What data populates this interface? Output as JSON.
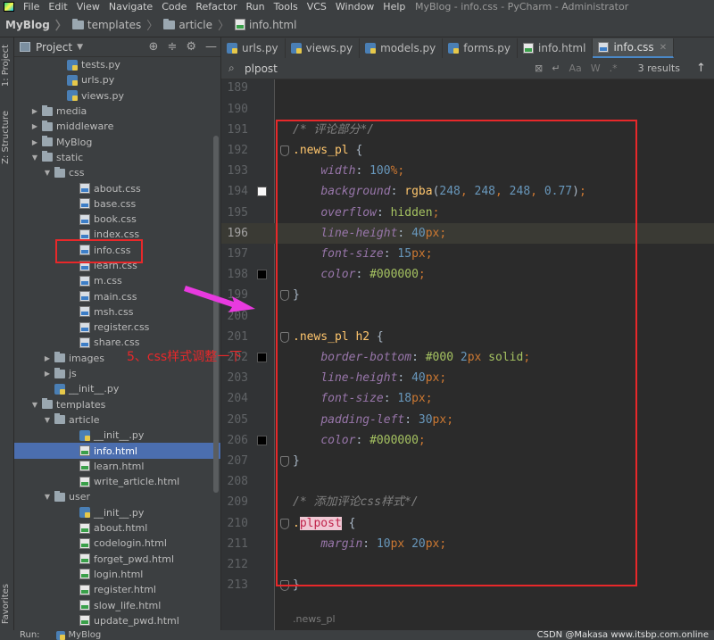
{
  "menubar": {
    "items": [
      "File",
      "Edit",
      "View",
      "Navigate",
      "Code",
      "Refactor",
      "Run",
      "Tools",
      "VCS",
      "Window",
      "Help"
    ],
    "window_title": "MyBlog - info.css - PyCharm - Administrator"
  },
  "breadcrumb": [
    "MyBlog",
    "templates",
    "article",
    "info.html"
  ],
  "left_strip": {
    "project_tab": "1: Project",
    "structure_tab": "Z: Structure",
    "favorites_tab": "Favorites"
  },
  "project_panel": {
    "title": "Project",
    "tree": [
      {
        "label": "tests.py",
        "type": "py",
        "depth": 4,
        "arrow": ""
      },
      {
        "label": "urls.py",
        "type": "py",
        "depth": 4,
        "arrow": ""
      },
      {
        "label": "views.py",
        "type": "py",
        "depth": 4,
        "arrow": ""
      },
      {
        "label": "media",
        "type": "folder",
        "depth": 2,
        "arrow": "▶"
      },
      {
        "label": "middleware",
        "type": "folder",
        "depth": 2,
        "arrow": "▶"
      },
      {
        "label": "MyBlog",
        "type": "folder",
        "depth": 2,
        "arrow": "▶"
      },
      {
        "label": "static",
        "type": "folder",
        "depth": 2,
        "arrow": "▼"
      },
      {
        "label": "css",
        "type": "folder",
        "depth": 3,
        "arrow": "▼"
      },
      {
        "label": "about.css",
        "type": "css",
        "depth": 5,
        "arrow": ""
      },
      {
        "label": "base.css",
        "type": "css",
        "depth": 5,
        "arrow": ""
      },
      {
        "label": "book.css",
        "type": "css",
        "depth": 5,
        "arrow": ""
      },
      {
        "label": "index.css",
        "type": "css",
        "depth": 5,
        "arrow": ""
      },
      {
        "label": "info.css",
        "type": "css",
        "depth": 5,
        "arrow": ""
      },
      {
        "label": "learn.css",
        "type": "css",
        "depth": 5,
        "arrow": ""
      },
      {
        "label": "m.css",
        "type": "css",
        "depth": 5,
        "arrow": ""
      },
      {
        "label": "main.css",
        "type": "css",
        "depth": 5,
        "arrow": ""
      },
      {
        "label": "msh.css",
        "type": "css",
        "depth": 5,
        "arrow": ""
      },
      {
        "label": "register.css",
        "type": "css",
        "depth": 5,
        "arrow": ""
      },
      {
        "label": "share.css",
        "type": "css",
        "depth": 5,
        "arrow": ""
      },
      {
        "label": "images",
        "type": "folder",
        "depth": 3,
        "arrow": "▶"
      },
      {
        "label": "js",
        "type": "folder",
        "depth": 3,
        "arrow": "▶"
      },
      {
        "label": "__init__.py",
        "type": "py",
        "depth": 3,
        "arrow": ""
      },
      {
        "label": "templates",
        "type": "folder",
        "depth": 2,
        "arrow": "▼"
      },
      {
        "label": "article",
        "type": "folder",
        "depth": 3,
        "arrow": "▼"
      },
      {
        "label": "__init__.py",
        "type": "py",
        "depth": 5,
        "arrow": ""
      },
      {
        "label": "info.html",
        "type": "html",
        "depth": 5,
        "arrow": "",
        "selected": true
      },
      {
        "label": "learn.html",
        "type": "html",
        "depth": 5,
        "arrow": ""
      },
      {
        "label": "write_article.html",
        "type": "html",
        "depth": 5,
        "arrow": ""
      },
      {
        "label": "user",
        "type": "folder",
        "depth": 3,
        "arrow": "▼"
      },
      {
        "label": "__init__.py",
        "type": "py",
        "depth": 5,
        "arrow": ""
      },
      {
        "label": "about.html",
        "type": "html",
        "depth": 5,
        "arrow": ""
      },
      {
        "label": "codelogin.html",
        "type": "html",
        "depth": 5,
        "arrow": ""
      },
      {
        "label": "forget_pwd.html",
        "type": "html",
        "depth": 5,
        "arrow": ""
      },
      {
        "label": "login.html",
        "type": "html",
        "depth": 5,
        "arrow": ""
      },
      {
        "label": "register.html",
        "type": "html",
        "depth": 5,
        "arrow": ""
      },
      {
        "label": "slow_life.html",
        "type": "html",
        "depth": 5,
        "arrow": ""
      },
      {
        "label": "update_pwd.html",
        "type": "html",
        "depth": 5,
        "arrow": ""
      }
    ]
  },
  "editor_tabs": [
    {
      "label": "urls.py",
      "type": "py",
      "active": false
    },
    {
      "label": "views.py",
      "type": "py",
      "active": false
    },
    {
      "label": "models.py",
      "type": "py",
      "active": false
    },
    {
      "label": "forms.py",
      "type": "py",
      "active": false
    },
    {
      "label": "info.html",
      "type": "html",
      "active": false
    },
    {
      "label": "info.css",
      "type": "css",
      "active": true
    }
  ],
  "search": {
    "value": "plpost",
    "results": "3 results",
    "options": [
      "Aa",
      "W",
      ".*"
    ]
  },
  "code_lines": [
    {
      "ln": "189",
      "tokens": []
    },
    {
      "ln": "190",
      "tokens": []
    },
    {
      "ln": "191",
      "tokens": [
        [
          "c-comment",
          "/* 评论部分*/"
        ]
      ]
    },
    {
      "ln": "192",
      "fold": true,
      "tokens": [
        [
          "c-sel",
          ".news_pl"
        ],
        [
          "c-text",
          " {"
        ]
      ]
    },
    {
      "ln": "193",
      "tokens": [
        [
          "c-text",
          "    "
        ],
        [
          "c-prop b",
          "width"
        ],
        [
          "c-text",
          ": "
        ],
        [
          "c-num",
          "100"
        ],
        [
          "c-unit",
          "%;"
        ]
      ]
    },
    {
      "ln": "194",
      "swatch": "#f8f8f8",
      "tokens": [
        [
          "c-text",
          "    "
        ],
        [
          "c-prop b",
          "background"
        ],
        [
          "c-text",
          ": "
        ],
        [
          "c-fn",
          "rgba"
        ],
        [
          "c-text",
          "("
        ],
        [
          "c-num",
          "248"
        ],
        [
          "c-kw",
          ", "
        ],
        [
          "c-num",
          "248"
        ],
        [
          "c-kw",
          ", "
        ],
        [
          "c-num",
          "248"
        ],
        [
          "c-kw",
          ", "
        ],
        [
          "c-num",
          "0.77"
        ],
        [
          "c-text",
          ")"
        ],
        [
          "c-kw",
          ";"
        ]
      ]
    },
    {
      "ln": "195",
      "tokens": [
        [
          "c-text",
          "    "
        ],
        [
          "c-prop b",
          "overflow"
        ],
        [
          "c-text",
          ": "
        ],
        [
          "c-color",
          "hidden"
        ],
        [
          "c-kw",
          ";"
        ]
      ]
    },
    {
      "ln": "196",
      "current": true,
      "tokens": [
        [
          "c-text",
          "    "
        ],
        [
          "c-prop b",
          "line-height"
        ],
        [
          "c-text",
          ": "
        ],
        [
          "c-num",
          "40"
        ],
        [
          "c-unit",
          "px"
        ],
        [
          "c-kw",
          ";"
        ]
      ]
    },
    {
      "ln": "197",
      "tokens": [
        [
          "c-text",
          "    "
        ],
        [
          "c-prop b",
          "font-size"
        ],
        [
          "c-text",
          ": "
        ],
        [
          "c-num",
          "15"
        ],
        [
          "c-unit",
          "px"
        ],
        [
          "c-kw",
          ";"
        ]
      ]
    },
    {
      "ln": "198",
      "swatch": "#000000",
      "tokens": [
        [
          "c-text",
          "    "
        ],
        [
          "c-prop b",
          "color"
        ],
        [
          "c-text",
          ": "
        ],
        [
          "c-color",
          "#000000"
        ],
        [
          "c-kw",
          ";"
        ]
      ]
    },
    {
      "ln": "199",
      "fold": true,
      "tokens": [
        [
          "c-text",
          "}"
        ]
      ]
    },
    {
      "ln": "200",
      "tokens": []
    },
    {
      "ln": "201",
      "fold": true,
      "tokens": [
        [
          "c-sel",
          ".news_pl h2"
        ],
        [
          "c-text",
          " {"
        ]
      ]
    },
    {
      "ln": "202",
      "swatch": "#000000",
      "tokens": [
        [
          "c-text",
          "    "
        ],
        [
          "c-prop b",
          "border-bottom"
        ],
        [
          "c-text",
          ": "
        ],
        [
          "c-color",
          "#000"
        ],
        [
          "c-text",
          " "
        ],
        [
          "c-num",
          "2"
        ],
        [
          "c-unit",
          "px"
        ],
        [
          "c-text",
          " "
        ],
        [
          "c-color",
          "solid"
        ],
        [
          "c-kw",
          ";"
        ]
      ]
    },
    {
      "ln": "203",
      "tokens": [
        [
          "c-text",
          "    "
        ],
        [
          "c-prop b",
          "line-height"
        ],
        [
          "c-text",
          ": "
        ],
        [
          "c-num",
          "40"
        ],
        [
          "c-unit",
          "px"
        ],
        [
          "c-kw",
          ";"
        ]
      ]
    },
    {
      "ln": "204",
      "tokens": [
        [
          "c-text",
          "    "
        ],
        [
          "c-prop b",
          "font-size"
        ],
        [
          "c-text",
          ": "
        ],
        [
          "c-num",
          "18"
        ],
        [
          "c-unit",
          "px"
        ],
        [
          "c-kw",
          ";"
        ]
      ]
    },
    {
      "ln": "205",
      "tokens": [
        [
          "c-text",
          "    "
        ],
        [
          "c-prop b",
          "padding-left"
        ],
        [
          "c-text",
          ": "
        ],
        [
          "c-num",
          "30"
        ],
        [
          "c-unit",
          "px"
        ],
        [
          "c-kw",
          ";"
        ]
      ]
    },
    {
      "ln": "206",
      "swatch": "#000000",
      "tokens": [
        [
          "c-text",
          "    "
        ],
        [
          "c-prop b",
          "color"
        ],
        [
          "c-text",
          ": "
        ],
        [
          "c-color",
          "#000000"
        ],
        [
          "c-kw",
          ";"
        ]
      ]
    },
    {
      "ln": "207",
      "fold": true,
      "tokens": [
        [
          "c-text",
          "}"
        ]
      ]
    },
    {
      "ln": "208",
      "tokens": []
    },
    {
      "ln": "209",
      "tokens": [
        [
          "c-comment",
          "/* 添加评论css样式*/"
        ]
      ]
    },
    {
      "ln": "210",
      "fold": true,
      "tokens": [
        [
          "c-sel",
          "."
        ],
        [
          "c-hl",
          "plpost"
        ],
        [
          "c-text",
          " {"
        ]
      ]
    },
    {
      "ln": "211",
      "tokens": [
        [
          "c-text",
          "    "
        ],
        [
          "c-prop b",
          "margin"
        ],
        [
          "c-text",
          ": "
        ],
        [
          "c-num",
          "10"
        ],
        [
          "c-unit",
          "px"
        ],
        [
          "c-text",
          " "
        ],
        [
          "c-num",
          "20"
        ],
        [
          "c-unit",
          "px"
        ],
        [
          "c-kw",
          ";"
        ]
      ]
    },
    {
      "ln": "212",
      "tokens": []
    },
    {
      "ln": "213",
      "fold": true,
      "tokens": [
        [
          "c-text",
          "}"
        ]
      ]
    }
  ],
  "editor_bottom_crumb": ".news_pl",
  "annotation": {
    "text": "5、css样式调整一下"
  },
  "statusbar": {
    "run_label": "Run:",
    "run_config": "MyBlog",
    "watermark": "CSDN @Makasa",
    "watermark_sub": "www.itsbp.com.online"
  }
}
